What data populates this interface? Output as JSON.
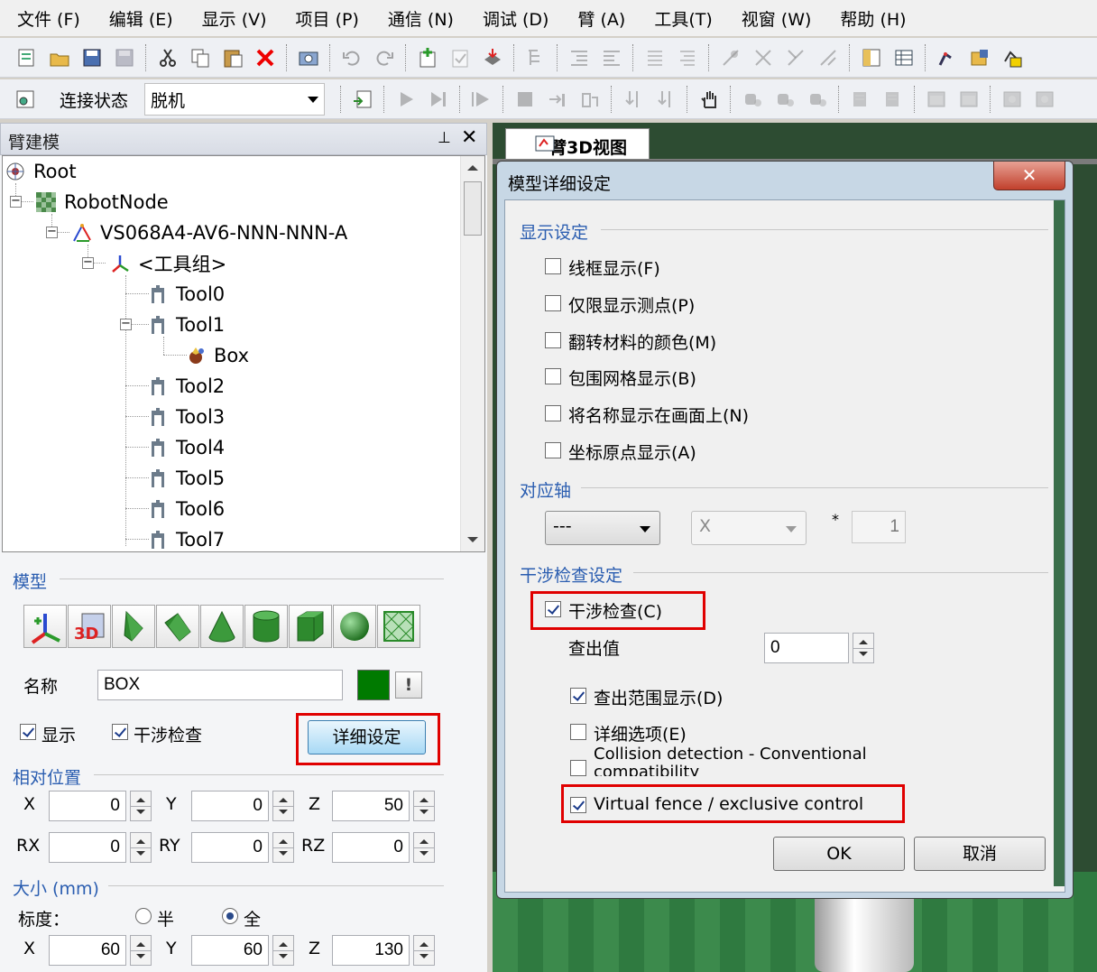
{
  "menubar": [
    "文件 (F)",
    "编辑 (E)",
    "显示 (V)",
    "项目 (P)",
    "通信 (N)",
    "调试 (D)",
    "臂 (A)",
    "工具(T)",
    "视窗 (W)",
    "帮助 (H)"
  ],
  "connection": {
    "label": "连接状态",
    "value": "脱机"
  },
  "left_panel": {
    "title": "臂建模",
    "tree": [
      {
        "label": "Root",
        "icon": "root-icon"
      },
      {
        "label": "RobotNode",
        "icon": "checker-icon"
      },
      {
        "label": "VS068A4-AV6-NNN-NNN-A",
        "icon": "robot-arm-icon"
      },
      {
        "label": "<工具组>",
        "icon": "axis-icon"
      },
      {
        "label": "Tool0",
        "icon": "tool-icon"
      },
      {
        "label": "Tool1",
        "icon": "tool-icon"
      },
      {
        "label": "Box",
        "icon": "box-shape-icon"
      },
      {
        "label": "Tool2",
        "icon": "tool-icon"
      },
      {
        "label": "Tool3",
        "icon": "tool-icon"
      },
      {
        "label": "Tool4",
        "icon": "tool-icon"
      },
      {
        "label": "Tool5",
        "icon": "tool-icon"
      },
      {
        "label": "Tool6",
        "icon": "tool-icon"
      },
      {
        "label": "Tool7",
        "icon": "tool-icon"
      }
    ],
    "model_group": "模型",
    "name_label": "名称",
    "name_value": "BOX",
    "color": "#007a00",
    "excl_label": "!",
    "show_label": "显示",
    "show_checked": true,
    "interf_label": "干涉检查",
    "interf_checked": true,
    "detail_button": "详细设定",
    "rel_pos_group": "相对位置",
    "pos": {
      "X": "0",
      "Y": "0",
      "Z": "50",
      "RX": "0",
      "RY": "0",
      "RZ": "0"
    },
    "size_group": "大小 (mm)",
    "scale_label": "标度：",
    "half_label": "半",
    "full_label": "全",
    "scale_selected": "全",
    "size": {
      "X": "60",
      "Y": "60",
      "Z": "130"
    }
  },
  "view": {
    "tab": "臂3D视图"
  },
  "dialog": {
    "title": "模型详细设定",
    "display_group": "显示设定",
    "display_options": [
      {
        "label": "线框显示(F)",
        "checked": false
      },
      {
        "label": "仅限显示测点(P)",
        "checked": false
      },
      {
        "label": "翻转材料的颜色(M)",
        "checked": false
      },
      {
        "label": "包围网格显示(B)",
        "checked": false
      },
      {
        "label": "将名称显示在画面上(N)",
        "checked": false
      },
      {
        "label": "坐标原点显示(A)",
        "checked": false
      }
    ],
    "axis_group": "对应轴",
    "axis_combo": "---",
    "axis_xyz": "X",
    "mult": "*",
    "axis_value": "1",
    "interference_group": "干涉检查设定",
    "interf_check": {
      "label": "干涉检查(C)",
      "checked": true
    },
    "detect_label": "查出值",
    "detect_value": "0",
    "options": [
      {
        "label": "查出范围显示(D)",
        "checked": true
      },
      {
        "label": "详细选项(E)",
        "checked": false
      },
      {
        "label": "Collision detection - Conventional compatibility",
        "checked": false
      },
      {
        "label": "Virtual fence / exclusive control",
        "checked": true
      }
    ],
    "ok": "OK",
    "cancel": "取消"
  }
}
